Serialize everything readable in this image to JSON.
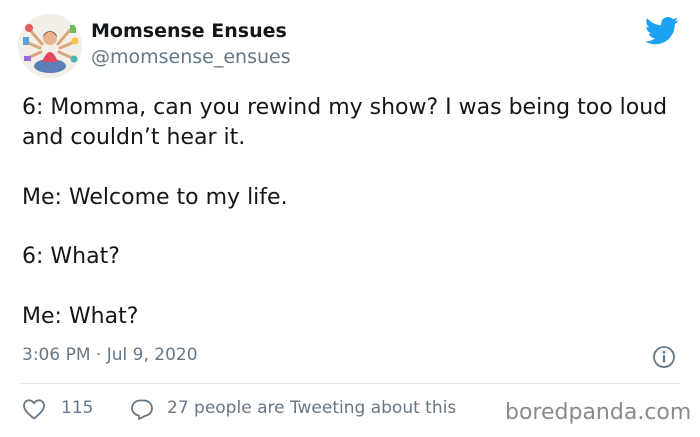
{
  "author": {
    "display_name": "Momsense Ensues",
    "handle": "@momsense_ensues",
    "avatar_icon": "avatar-illustration-icon"
  },
  "brand": {
    "icon": "twitter-bird-icon",
    "color": "#1da1f2"
  },
  "tweet": {
    "paragraphs": [
      "6: Momma, can you rewind my show? I was being too loud and couldn’t hear it.",
      "Me: Welcome to my life.",
      "6: What?",
      "Me: What?"
    ],
    "timestamp": "3:06 PM · Jul 9, 2020"
  },
  "actions": {
    "like_icon": "heart-icon",
    "like_count": "115",
    "reply_icon": "speech-bubble-icon",
    "discussion_text": "27 people are Tweeting about this",
    "info_icon": "info-icon"
  },
  "watermark": "boredpanda.com",
  "colors": {
    "text": "#14171a",
    "secondary": "#657786",
    "divider": "#e1e8ed"
  }
}
